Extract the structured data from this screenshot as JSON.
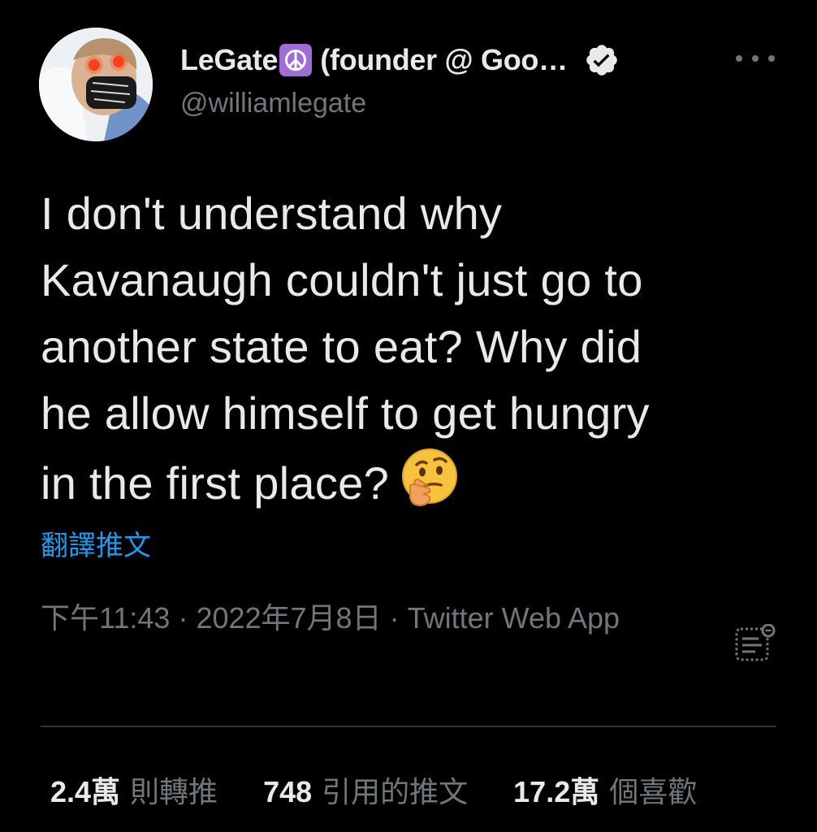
{
  "author": {
    "display_name": "LeGate",
    "display_name_rest": "(founder @ Goo…",
    "handle": "@williamlegate",
    "badge_icon": "peace-symbol-icon",
    "verified_icon": "verified-badge-icon"
  },
  "tweet": {
    "lines": [
      "I don't understand why",
      "Kavanaugh couldn't just go to",
      "another state to eat? Why did",
      "he allow himself to get hungry",
      "in the first place?"
    ],
    "emoji": "thinking-face-emoji"
  },
  "translate_label": "翻譯推文",
  "meta": {
    "time": "下午11:43",
    "separator": "·",
    "date": "2022年7月8日",
    "source": "Twitter Web App"
  },
  "stats": [
    {
      "value": "2.4萬",
      "label": "則轉推"
    },
    {
      "value": "748",
      "label": "引用的推文"
    },
    {
      "value": "17.2萬",
      "label": "個喜歡"
    }
  ],
  "colors": {
    "background": "#000000",
    "text_primary": "#e7e9ea",
    "text_secondary": "#71767b",
    "link": "#1d9bf0",
    "divider": "#2f3336",
    "peace_badge": "#a06cd5"
  }
}
